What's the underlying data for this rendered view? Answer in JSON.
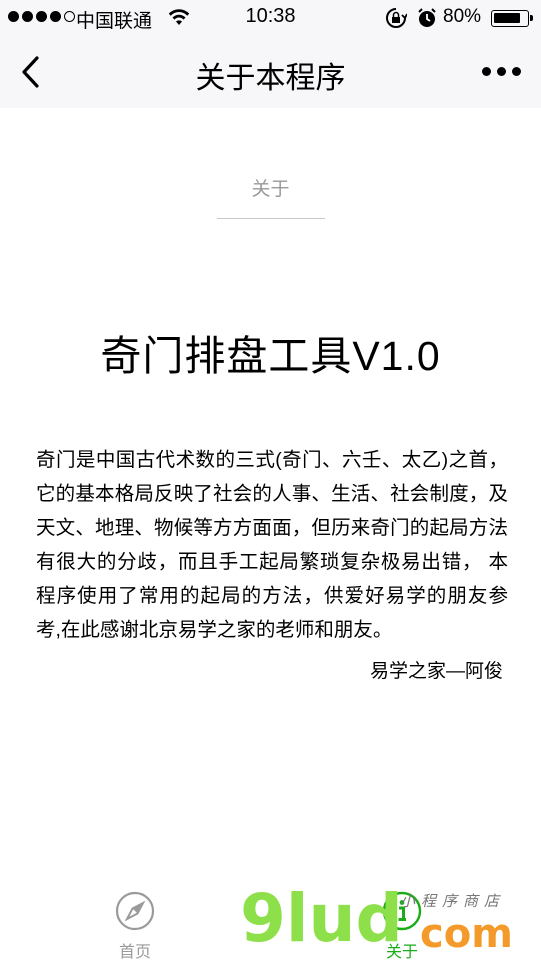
{
  "status_bar": {
    "carrier": "中国联通",
    "time": "10:38",
    "battery_percent": "80%",
    "battery_level": 0.8,
    "signal_dots_filled": 4,
    "signal_dots_total": 5
  },
  "navbar": {
    "title": "关于本程序",
    "back_icon": "chevron-left-icon",
    "more_icon": "more-dots-icon"
  },
  "content": {
    "section_label": "关于",
    "app_title": "奇门排盘工具V1.0",
    "description": "奇门是中国古代术数的三式(奇门、六壬、太乙)之首， 它的基本格局反映了社会的人事、生活、社会制度，及天文、地理、物候等方方面面，但历来奇门的起局方法有很大的分歧，而且手工起局繁琐复杂极易出错， 本程序使用了常用的起局的方法，供爱好易学的朋友参考,在此感谢北京易学之家的老师和朋友。",
    "signature": "易学之家—阿俊"
  },
  "tabbar": {
    "tabs": [
      {
        "label": "首页",
        "icon": "compass-icon"
      },
      {
        "label": "关于",
        "icon": "info-icon"
      }
    ],
    "active_color": "#1aad19",
    "inactive_color": "#9a9a9a"
  },
  "watermark": {
    "logo_text": "9lud",
    "domain_text": "com",
    "sub_text": "小程序商店"
  }
}
